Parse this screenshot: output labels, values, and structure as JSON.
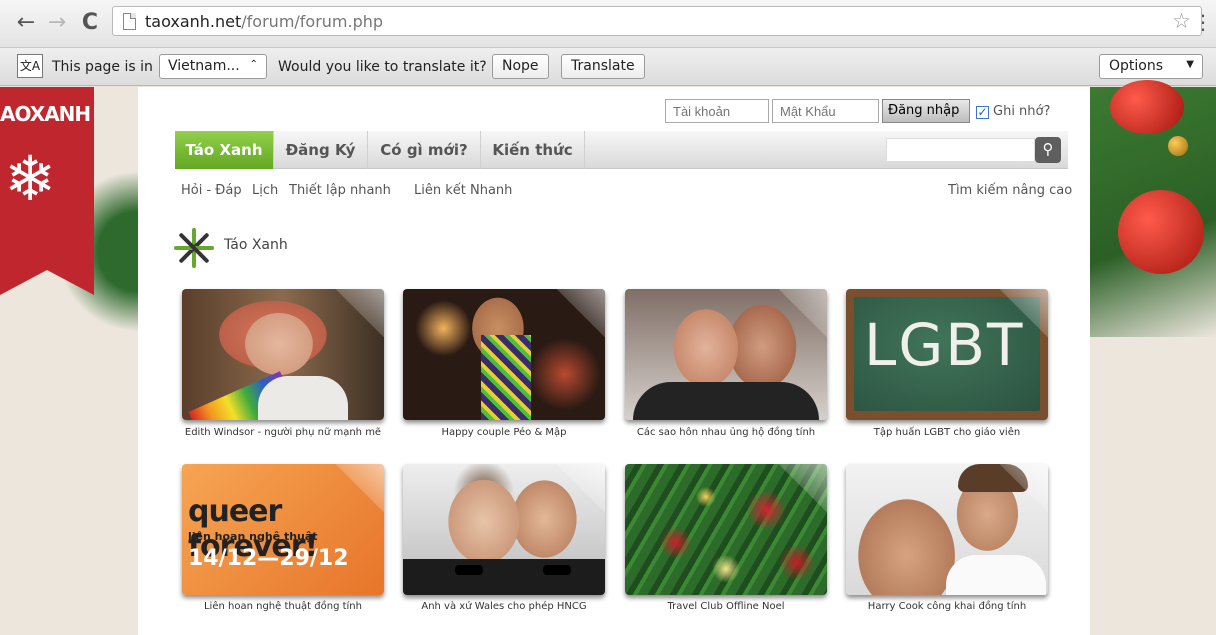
{
  "browser": {
    "url_host": "taoxanh.net",
    "url_path": "/forum/forum.php",
    "back_icon": "←",
    "forward_icon": "→",
    "reload_icon": "C",
    "star_icon": "☆",
    "menu_icon": "⋮"
  },
  "translate_bar": {
    "icon_label": "文A",
    "text_before": "This page is in",
    "language": "Vietnam...",
    "language_caret": "⌃",
    "question": "Would you like to translate it?",
    "nope_label": "Nope",
    "translate_label": "Translate",
    "options_label": "Options",
    "options_caret": "▼"
  },
  "site": {
    "ribbon_text": "AOXANH",
    "snowflake": "❄",
    "accent_color": "#76bd34"
  },
  "login": {
    "username_placeholder": "Tài khoản",
    "password_placeholder": "Mật Khẩu",
    "login_label": "Đăng nhập",
    "remember_check": "✓",
    "remember_label": "Ghi nhớ?"
  },
  "navbar": {
    "items": [
      "Táo Xanh",
      "Đăng Ký",
      "Có gì mới?",
      "Kiến thức"
    ],
    "search_icon": "⚲"
  },
  "subnav": {
    "items": [
      "Hỏi - Đáp",
      "Lịch",
      "Thiết lập nhanh",
      "Liên kết Nhanh"
    ],
    "advanced_search": "Tìm kiếm nâng cao"
  },
  "breadcrumb": {
    "label": "Táo Xanh"
  },
  "tiles": [
    {
      "caption": "Edith Windsor - người phụ nữ mạnh mẽ"
    },
    {
      "caption": "Happy couple Péo & Mập"
    },
    {
      "caption": "Các sao hôn nhau ủng hộ đồng tính"
    },
    {
      "caption": "Tập huấn LGBT cho giáo viên",
      "image_text": "LGBT"
    },
    {
      "caption": "Liên hoan nghệ thuật đồng tính",
      "image_text": [
        "queer forever!",
        "liên hoan nghệ thuật",
        "14/12—29/12"
      ]
    },
    {
      "caption": "Anh và xứ Wales cho phép HNCG"
    },
    {
      "caption": "Travel Club Offline Noel"
    },
    {
      "caption": "Harry Cook công khai đồng tính"
    }
  ]
}
